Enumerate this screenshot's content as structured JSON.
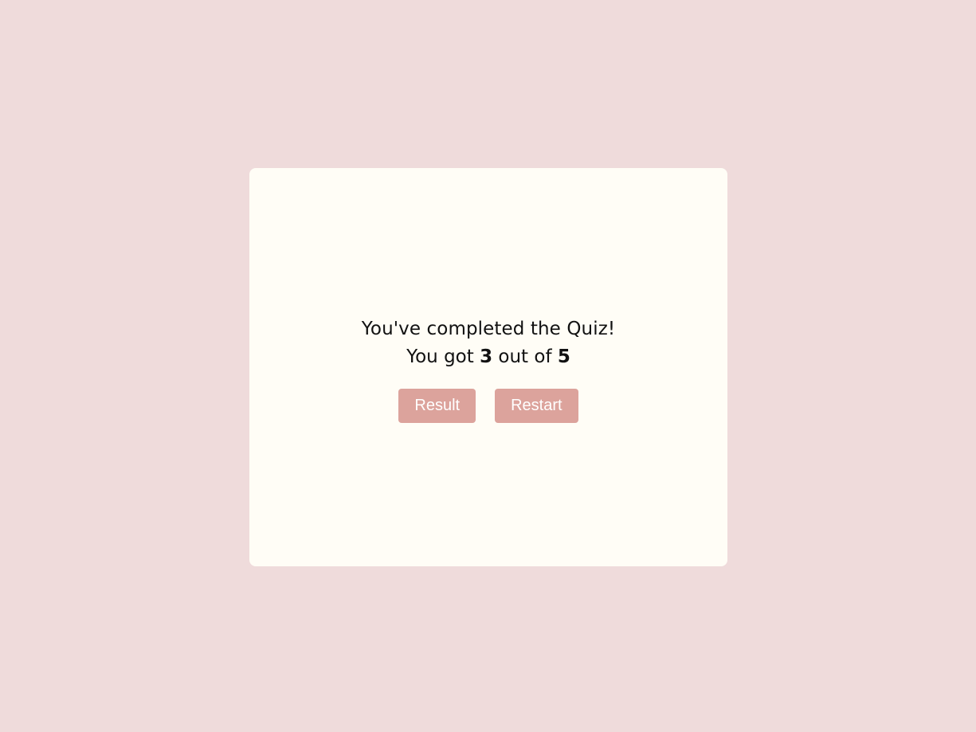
{
  "colors": {
    "page_background": "#efdbdb",
    "card_background": "#fffdf6",
    "button_background": "#dca39c",
    "button_text": "#ffffff",
    "text": "#111111"
  },
  "quiz": {
    "completed_message": "You've completed the Quiz!",
    "score_prefix": "You got ",
    "score_correct": "3",
    "score_middle": " out of ",
    "score_total": "5"
  },
  "actions": {
    "result_label": "Result",
    "restart_label": "Restart"
  }
}
